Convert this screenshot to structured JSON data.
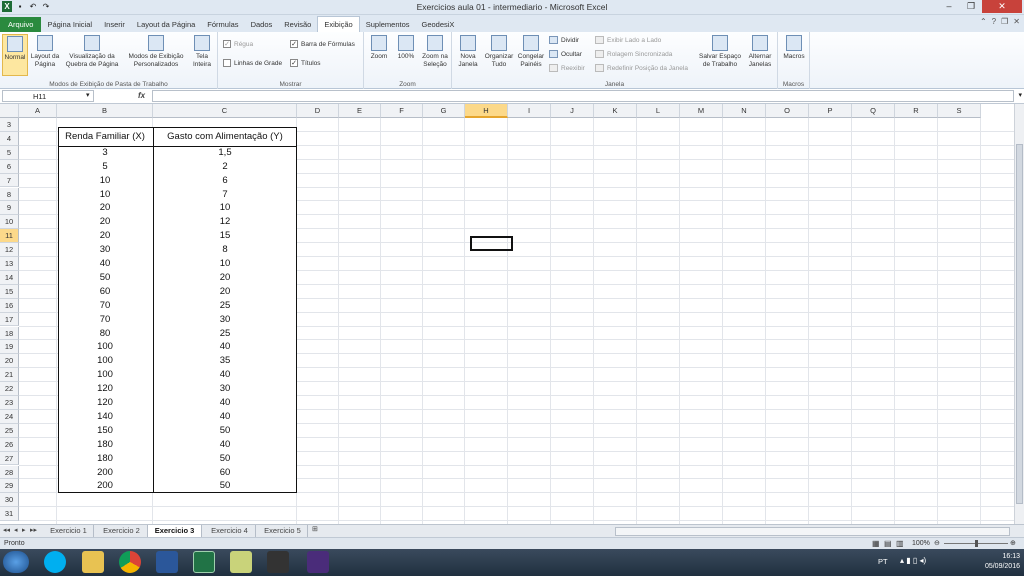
{
  "window": {
    "title": "Exercicios aula 01 - intermediario - Microsoft Excel"
  },
  "ribbon_tabs": [
    "Arquivo",
    "Página Inicial",
    "Inserir",
    "Layout da Página",
    "Fórmulas",
    "Dados",
    "Revisão",
    "Exibição",
    "Suplementos",
    "GeodesiX"
  ],
  "active_tab": "Exibição",
  "ribbon": {
    "workbook_views": {
      "label": "Modos de Exibição de Pasta de Trabalho",
      "normal": "Normal",
      "page_layout": "Layout da Página",
      "page_break": "Visualização da Quebra de Página",
      "custom": "Modos de Exibição Personalizados",
      "full_screen": "Tela Inteira"
    },
    "show": {
      "label": "Mostrar",
      "ruler": "Régua",
      "formula_bar": "Barra de Fórmulas",
      "gridlines": "Linhas de Grade",
      "headings": "Títulos"
    },
    "zoom": {
      "label": "Zoom",
      "zoom": "Zoom",
      "hundred": "100%",
      "to_selection": "Zoom na Seleção"
    },
    "window": {
      "label": "Janela",
      "new_window": "Nova Janela",
      "arrange_all": "Organizar Tudo",
      "freeze": "Congelar Painéis",
      "split": "Dividir",
      "hide": "Ocultar",
      "unhide": "Reexibir",
      "side_by_side": "Exibir Lado a Lado",
      "sync_scroll": "Rolagem Sincronizada",
      "reset_pos": "Redefinir Posição da Janela",
      "save_workspace": "Salvar Espaço de Trabalho",
      "switch_windows": "Alternar Janelas"
    },
    "macros": {
      "label": "Macros",
      "macros": "Macros"
    }
  },
  "formula_bar": {
    "name_box": "H11",
    "fx": "fx",
    "value": ""
  },
  "columns": [
    "A",
    "B",
    "C",
    "D",
    "E",
    "F",
    "G",
    "H",
    "I",
    "J",
    "K",
    "L",
    "M",
    "N",
    "O",
    "P",
    "Q",
    "R",
    "S"
  ],
  "active_column": "H",
  "active_row": "11",
  "rows": [
    "3",
    "4",
    "5",
    "6",
    "7",
    "8",
    "9",
    "10",
    "11",
    "12",
    "13",
    "14",
    "15",
    "16",
    "17",
    "18",
    "19",
    "20",
    "21",
    "22",
    "23",
    "24",
    "25",
    "26",
    "27",
    "28",
    "29",
    "30",
    "31"
  ],
  "table": {
    "header_x": "Renda Familiar (X)",
    "header_y": "Gasto com Alimentação (Y)",
    "x": [
      "3",
      "5",
      "10",
      "10",
      "20",
      "20",
      "20",
      "30",
      "40",
      "50",
      "60",
      "70",
      "70",
      "80",
      "100",
      "100",
      "100",
      "120",
      "120",
      "140",
      "150",
      "180",
      "180",
      "200",
      "200"
    ],
    "y": [
      "1,5",
      "2",
      "6",
      "7",
      "10",
      "12",
      "15",
      "8",
      "10",
      "20",
      "20",
      "25",
      "30",
      "25",
      "40",
      "35",
      "40",
      "30",
      "40",
      "40",
      "50",
      "40",
      "50",
      "60",
      "50"
    ]
  },
  "sheets": [
    "Exercicio 1",
    "Exercicio 2",
    "Exercicio 3",
    "Exercicio 4",
    "Exercicio 5"
  ],
  "active_sheet": "Exercicio 3",
  "status": {
    "ready": "Pronto",
    "zoom": "100%"
  },
  "taskbar": {
    "lang": "PT",
    "time": "16:13",
    "date": "05/09/2016"
  }
}
